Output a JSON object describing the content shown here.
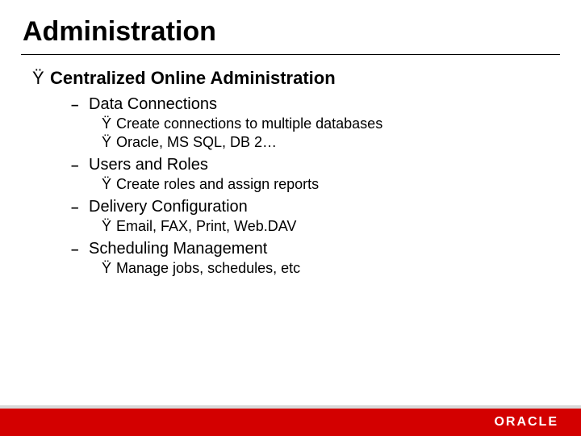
{
  "title": "Administration",
  "bullet_glyph": "Ÿ",
  "dash_glyph": "–",
  "main": {
    "heading": "Centralized Online Administration",
    "items": [
      {
        "label": "Data Connections",
        "sub": [
          "Create connections to multiple databases",
          "Oracle, MS SQL, DB 2…"
        ]
      },
      {
        "label": "Users and Roles",
        "sub": [
          "Create roles and assign reports"
        ]
      },
      {
        "label": "Delivery Configuration",
        "sub": [
          "Email, FAX, Print, Web.DAV"
        ]
      },
      {
        "label": "Scheduling Management",
        "sub": [
          "Manage jobs, schedules, etc"
        ]
      }
    ]
  },
  "footer": {
    "brand": "ORACLE"
  }
}
